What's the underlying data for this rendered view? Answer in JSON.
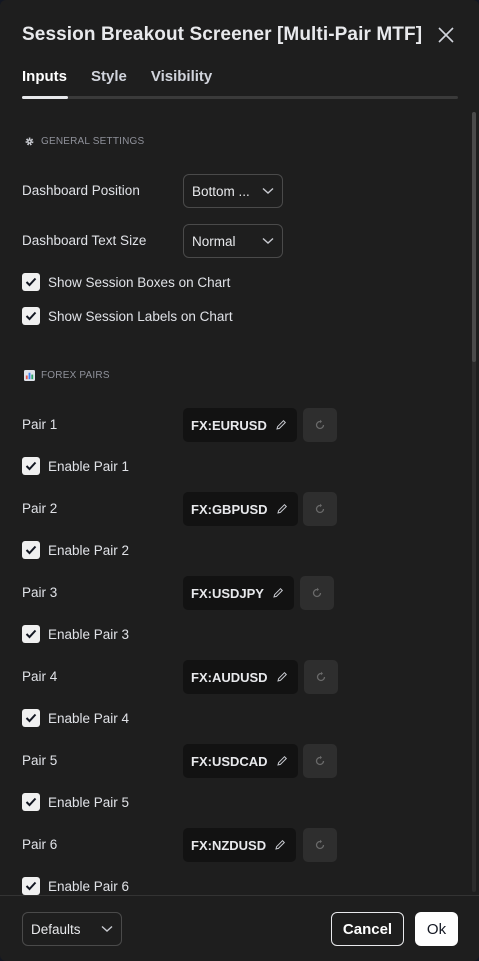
{
  "dialog": {
    "title": "Session Breakout Screener [Multi-Pair MTF]",
    "close_icon": "close-icon"
  },
  "tabs": [
    {
      "label": "Inputs",
      "active": true
    },
    {
      "label": "Style",
      "active": false
    },
    {
      "label": "Visibility",
      "active": false
    }
  ],
  "general": {
    "heading": "GENERAL SETTINGS",
    "icon": "gear-icon",
    "dashboard_position": {
      "label": "Dashboard Position",
      "value": "Bottom ..."
    },
    "dashboard_text_size": {
      "label": "Dashboard Text Size",
      "value": "Normal"
    },
    "show_boxes": {
      "label": "Show Session Boxes on Chart",
      "checked": true
    },
    "show_labels": {
      "label": "Show Session Labels on Chart",
      "checked": true
    }
  },
  "forex": {
    "heading": "FOREX PAIRS",
    "icon": "bar-chart-icon",
    "pairs": [
      {
        "label": "Pair 1",
        "symbol": "FX:EURUSD",
        "enable_label": "Enable Pair 1",
        "enabled": true
      },
      {
        "label": "Pair 2",
        "symbol": "FX:GBPUSD",
        "enable_label": "Enable Pair 2",
        "enabled": true
      },
      {
        "label": "Pair 3",
        "symbol": "FX:USDJPY",
        "enable_label": "Enable Pair 3",
        "enabled": true
      },
      {
        "label": "Pair 4",
        "symbol": "FX:AUDUSD",
        "enable_label": "Enable Pair 4",
        "enabled": true
      },
      {
        "label": "Pair 5",
        "symbol": "FX:USDCAD",
        "enable_label": "Enable Pair 5",
        "enabled": true
      },
      {
        "label": "Pair 6",
        "symbol": "FX:NZDUSD",
        "enable_label": "Enable Pair 6",
        "enabled": true
      }
    ]
  },
  "footer": {
    "defaults_label": "Defaults",
    "cancel_label": "Cancel",
    "ok_label": "Ok"
  },
  "colors": {
    "background": "#1e1e1e",
    "text": "#e0e2e7",
    "muted": "#8f919a",
    "field": "#121212"
  }
}
